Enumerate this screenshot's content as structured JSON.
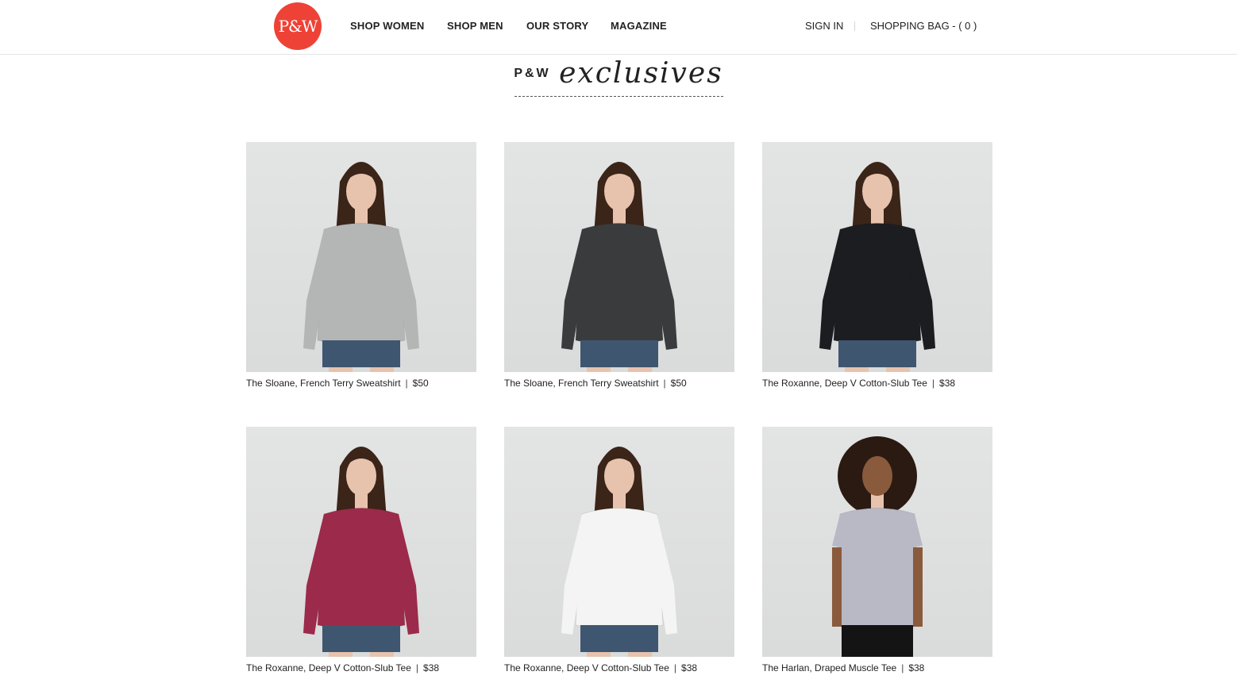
{
  "header": {
    "logo_text": "P&W",
    "nav": [
      "SHOP WOMEN",
      "SHOP MEN",
      "OUR STORY",
      "MAGAZINE"
    ],
    "sign_in": "SIGN IN",
    "shopping_bag": "SHOPPING BAG - ( 0 )"
  },
  "headline": {
    "brand": "P&W",
    "script": "exclusives"
  },
  "products": [
    {
      "name": "The Sloane, French Terry Sweatshirt",
      "price": "$50",
      "garment_color": "#b4b5b5"
    },
    {
      "name": "The Sloane, French Terry Sweatshirt",
      "price": "$50",
      "garment_color": "#3a3b3c"
    },
    {
      "name": "The Roxanne, Deep V Cotton-Slub Tee",
      "price": "$38",
      "garment_color": "#1c1d20"
    },
    {
      "name": "The Roxanne, Deep V Cotton-Slub Tee",
      "price": "$38",
      "garment_color": "#9c2a4a"
    },
    {
      "name": "The Roxanne, Deep V Cotton-Slub Tee",
      "price": "$38",
      "garment_color": "#f4f4f4"
    },
    {
      "name": "The Harlan, Draped Muscle Tee",
      "price": "$38",
      "garment_color": "#b9b9c6"
    }
  ],
  "colors": {
    "logo": "#ee4237",
    "photo_background": "#dfe0e0",
    "skin": "#e7c3ae",
    "hair": "#3b2418",
    "denim": "#3f5670"
  }
}
